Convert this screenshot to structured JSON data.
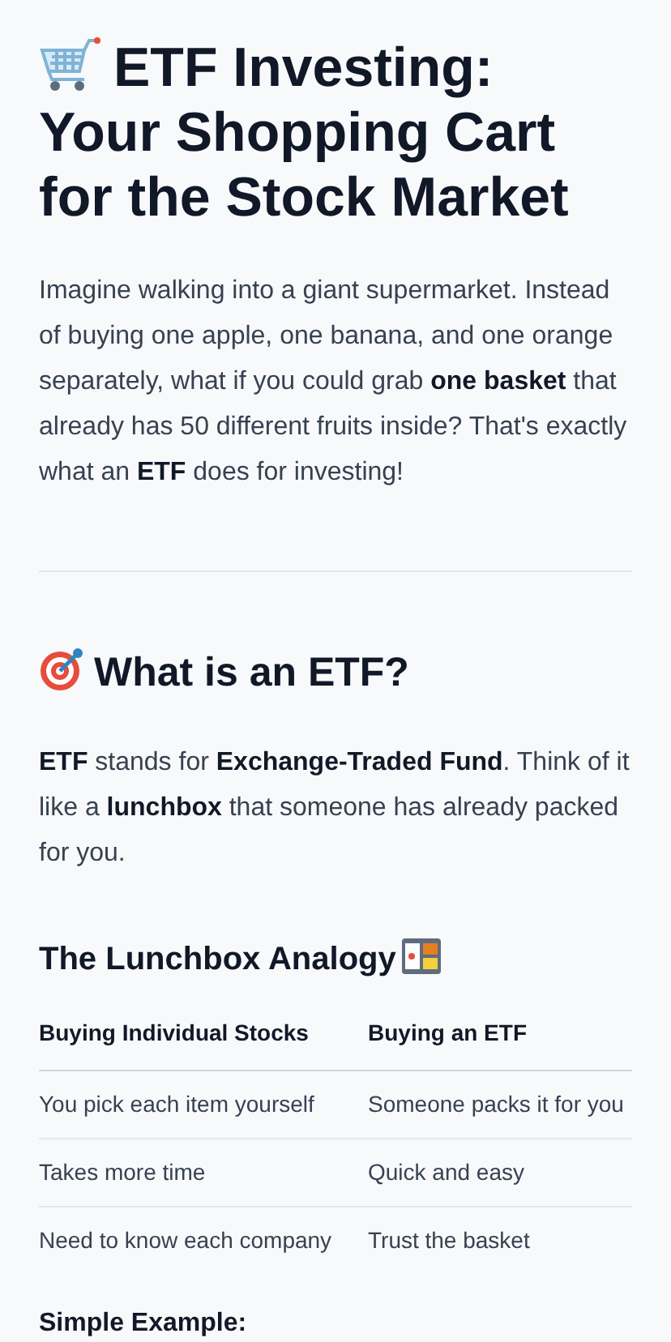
{
  "title_lines": [
    "ETF Investing:",
    "Your Shopping Cart for the Stock Market"
  ],
  "intro": "Imagine walking into a giant supermarket. Instead of buying one apple, one banana, and one orange separately, what if you could grab **one basket** that already has 50 different fruits inside? That's exactly what an **ETF** does for investing!",
  "section": {
    "heading": "What is an ETF?",
    "text": "**ETF** stands for **Exchange-Traded Fund**. Think of it like a **lunchbox** that someone has already packed for you.",
    "subheading": "The Lunchbox Analogy",
    "table": {
      "columns": [
        "Buying Individual Stocks",
        "Buying an ETF"
      ],
      "rows": [
        [
          "You pick each item yourself",
          "Someone packs it for you"
        ],
        [
          "Takes more time",
          "Quick and easy"
        ],
        [
          "Need to know each company",
          "Trust the basket"
        ]
      ]
    },
    "next_heading": "Simple Example:"
  }
}
